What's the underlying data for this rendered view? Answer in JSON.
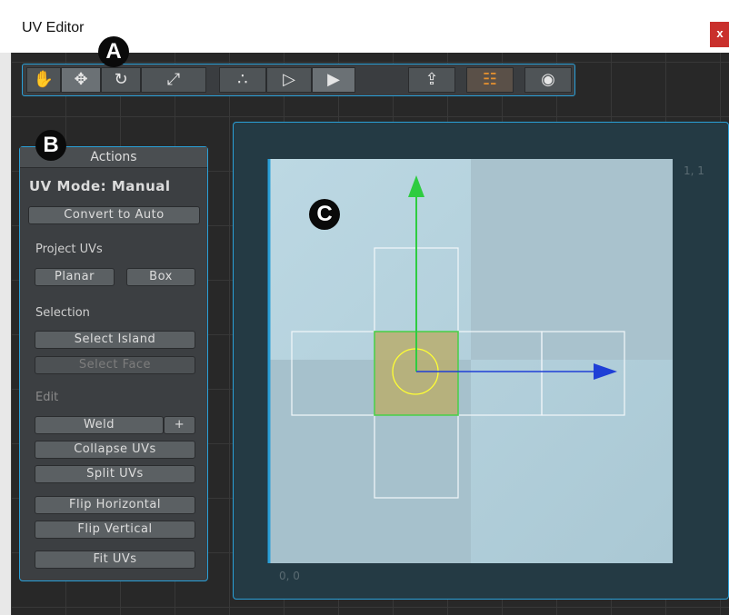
{
  "window": {
    "title": "UV Editor",
    "close_label": "x"
  },
  "callouts": {
    "a": "A",
    "b": "B",
    "c": "C"
  },
  "toolbar": {
    "groups": [
      {
        "tools": [
          {
            "name": "pan-tool",
            "icon": "hand-icon",
            "glyph": "✋",
            "active": false
          },
          {
            "name": "move-tool",
            "icon": "move-icon",
            "glyph": "✥",
            "active": true
          },
          {
            "name": "rotate-tool",
            "icon": "rotate-icon",
            "glyph": "↻",
            "active": false
          },
          {
            "name": "scale-tool",
            "icon": "scale-icon",
            "glyph": "⤢",
            "active": false
          }
        ]
      },
      {
        "tools": [
          {
            "name": "vertex-mode",
            "icon": "vertex-icon",
            "glyph": "∴",
            "active": false
          },
          {
            "name": "edge-mode",
            "icon": "edge-icon",
            "glyph": "▷",
            "active": false
          },
          {
            "name": "face-mode",
            "icon": "face-icon",
            "glyph": "▶",
            "active": true
          }
        ]
      },
      {
        "tools": [
          {
            "name": "export-uv",
            "icon": "export-icon",
            "glyph": "⇪",
            "active": false
          },
          {
            "name": "toggle-background",
            "icon": "background-icon",
            "glyph": "☷",
            "active": false
          },
          {
            "name": "screenshot",
            "icon": "camera-icon",
            "glyph": "◉",
            "active": false
          }
        ]
      }
    ]
  },
  "actions": {
    "title": "Actions",
    "mode_label": "UV Mode: Manual",
    "convert_label": "Convert to Auto",
    "project_heading": "Project UVs",
    "planar_label": "Planar",
    "box_label": "Box",
    "selection_heading": "Selection",
    "select_island_label": "Select Island",
    "select_face_label": "Select Face",
    "edit_heading": "Edit",
    "weld_label": "Weld",
    "weld_plus_label": "+",
    "collapse_label": "Collapse UVs",
    "split_label": "Split UVs",
    "flip_h_label": "Flip Horizontal",
    "flip_v_label": "Flip Vertical",
    "fit_label": "Fit UVs"
  },
  "canvas": {
    "corner_top_right": "1, 1",
    "corner_bottom_left": "0, 0",
    "colors": {
      "uv_bg": "#b4d3df",
      "uv_bg_alt": "#a8c3cf",
      "selection_fill": "#b7ae6e",
      "selection_border": "#4ccd4c",
      "y_axis": "#2ecc40",
      "x_axis": "#1f3fd6",
      "handle": "#ffff33"
    }
  }
}
